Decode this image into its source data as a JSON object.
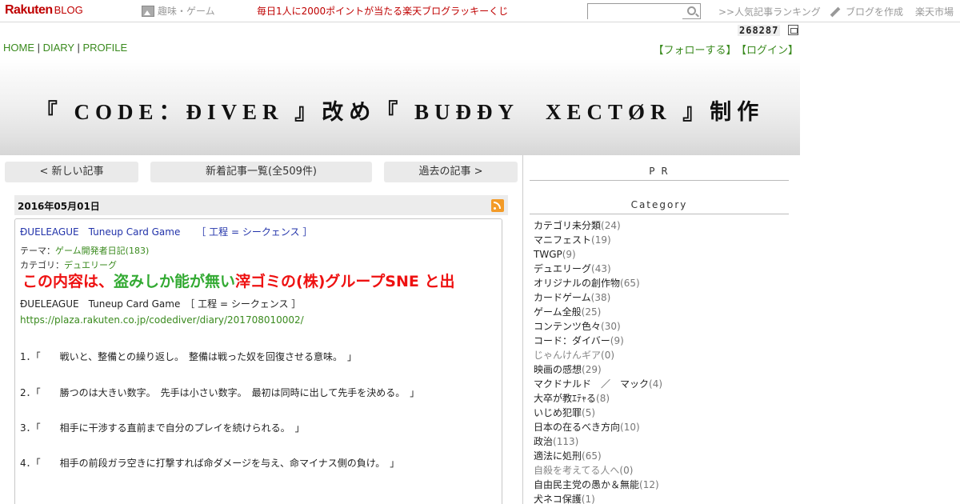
{
  "topbar": {
    "logo_main": "Rakuten",
    "logo_sub": "BLOG",
    "category_link": "趣味・ゲーム",
    "lottery": "毎日1人に2000ポイントが当たる楽天ブログラッキーくじ",
    "search_placeholder": "",
    "ranking": ">>人気記事ランキング",
    "create_blog": "ブログを作成",
    "market": "楽天市場"
  },
  "counter": "268287",
  "nav": {
    "home": "HOME",
    "sep1": " | ",
    "diary": "DIARY",
    "sep2": " | ",
    "profile": "PROFILE",
    "follow": "【フォローする】",
    "login": "【ログイン】"
  },
  "blog_title": "『 CODE：ÐIVER 』改め『 BUÐÐY　XECTØR 』制作",
  "pager": {
    "newer": "< 新しい記事",
    "list": "新着記事一覧(全509件)",
    "older": "過去の記事 >"
  },
  "article": {
    "date": "2016年05月01日",
    "title": "ÐUELEAGUE　Tuneup Card Game",
    "title_process": "［ 工程 = シークェンス ］",
    "theme_label": "テーマ：",
    "theme_value": "ゲーム開発者日記(183)",
    "category_label": "カテゴリ：",
    "category_value": "デュエリーグ",
    "heading": "ÐUELEAGUE　Tuneup Card Game　［ 工程 = シークェンス ］",
    "link": "https://plaza.rakuten.co.jp/codediver/diary/201708010002/",
    "items": [
      "1．「　　戦いと、整備との繰り返し。　整備は戦った奴を回復させる意味。　」",
      "2．「　　勝つのは大きい数字。　先手は小さい数字。　最初は同時に出して先手を決める。　」",
      "3．「　　相手に干渉する直前まで自分のプレイを続けられる。　」",
      "4．「　　相手の前段ガラ空きに打撃すれば命ダメージを与え、命マイナス側の負け。　」"
    ],
    "notice_red1": "この内容は、",
    "notice_green": "盗みしか能が無い",
    "notice_red2": "滓ゴミの(株)グループSNE と出"
  },
  "sidebar": {
    "pr_heading": "P R",
    "category_heading": "Category",
    "categories": [
      {
        "name": "カテゴリ未分類",
        "count": "(24)"
      },
      {
        "name": "マニフェスト",
        "count": "(19)"
      },
      {
        "name": "TWGP",
        "count": "(9)"
      },
      {
        "name": "デュエリーグ",
        "count": "(43)"
      },
      {
        "name": "オリジナルの創作物",
        "count": "(65)"
      },
      {
        "name": "カードゲーム",
        "count": "(38)"
      },
      {
        "name": "ゲーム全般",
        "count": "(25)"
      },
      {
        "name": "コンテンツ色々",
        "count": "(30)"
      },
      {
        "name": "コード：ダイバー",
        "count": "(9)"
      },
      {
        "name": "じゃんけんギア",
        "count": "(0)"
      },
      {
        "name": "映画の感想",
        "count": "(29)"
      },
      {
        "name": "マクドナルド　／　マック",
        "count": "(4)"
      },
      {
        "name": "大卒が教ｴﾃｬる",
        "count": "(8)"
      },
      {
        "name": "いじめ犯罪",
        "count": "(5)"
      },
      {
        "name": "日本の在るべき方向",
        "count": "(10)"
      },
      {
        "name": "政治",
        "count": "(113)"
      },
      {
        "name": "適法に処刑",
        "count": "(65)"
      },
      {
        "name": "自殺を考えてる人へ",
        "count": "(0)"
      },
      {
        "name": "自由民主党の愚か＆無能",
        "count": "(12)"
      },
      {
        "name": "犬ネコ保護",
        "count": "(1)"
      }
    ]
  }
}
